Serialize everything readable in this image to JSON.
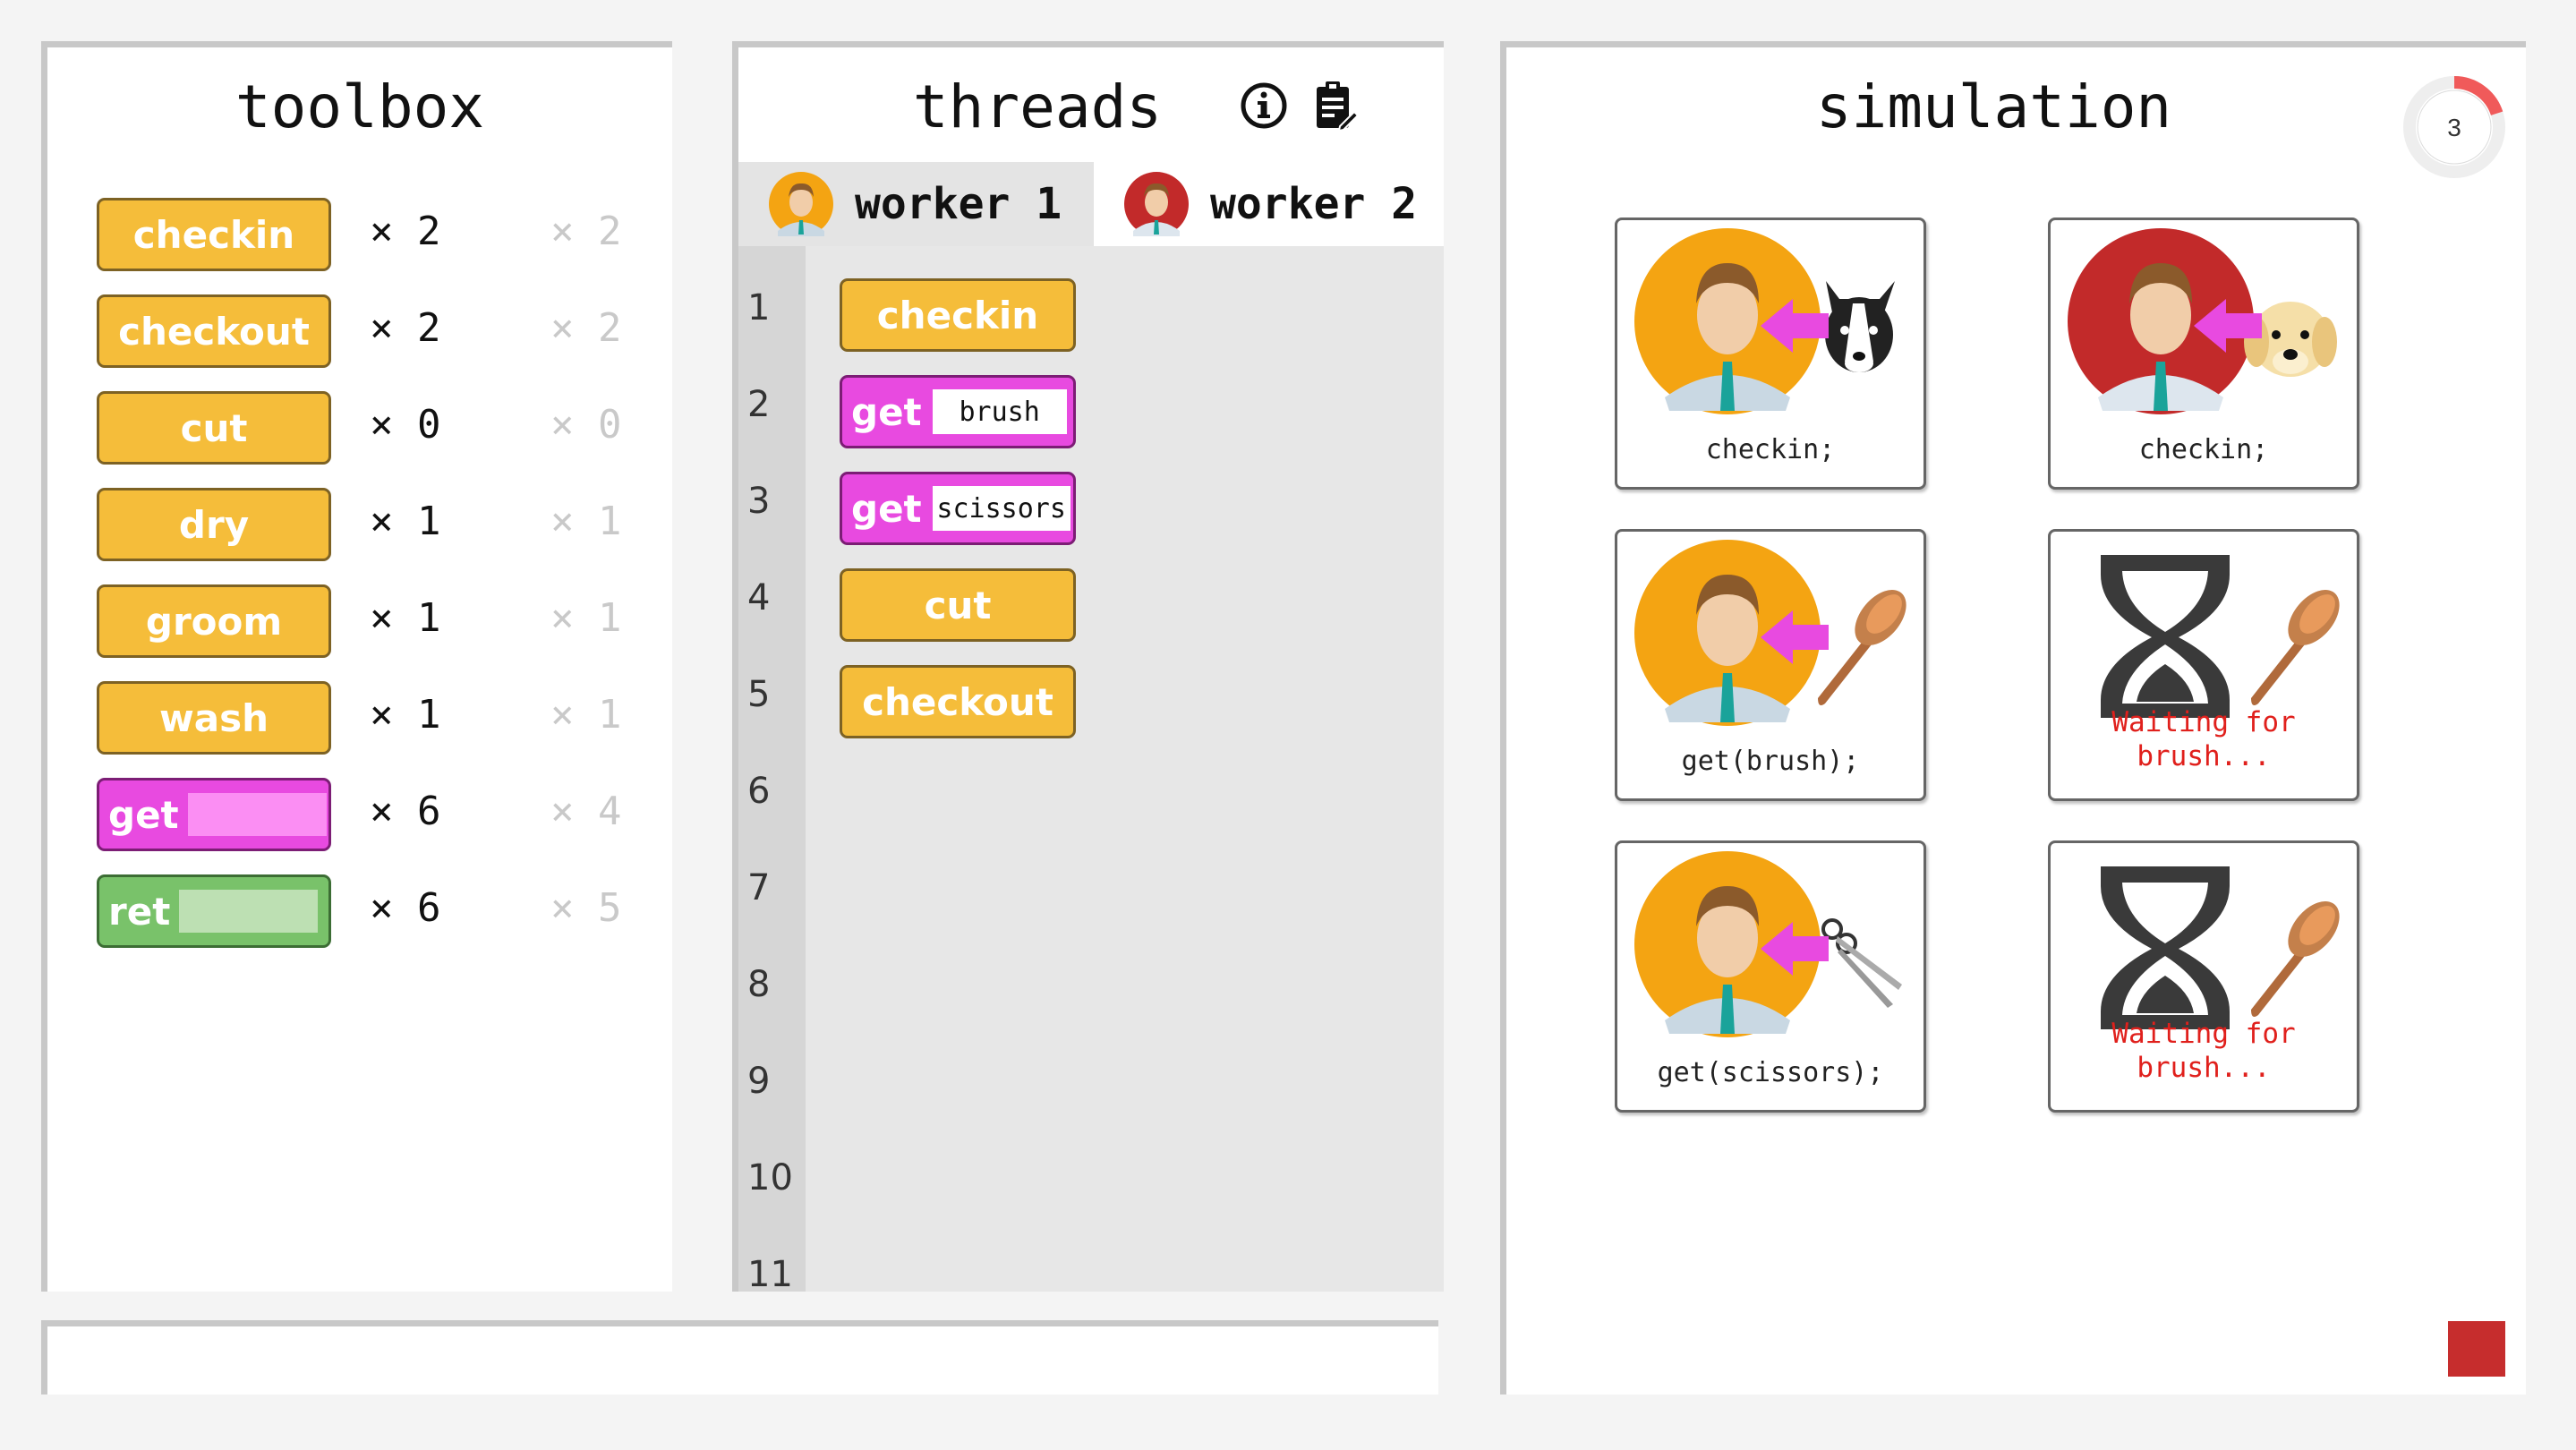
{
  "toolbox": {
    "title": "toolbox",
    "items": [
      {
        "label": "checkin",
        "kind": "orange",
        "count": "× 2",
        "remaining": "× 2"
      },
      {
        "label": "checkout",
        "kind": "orange",
        "count": "× 2",
        "remaining": "× 2"
      },
      {
        "label": "cut",
        "kind": "orange",
        "count": "× 0",
        "remaining": "× 0"
      },
      {
        "label": "dry",
        "kind": "orange",
        "count": "× 1",
        "remaining": "× 1"
      },
      {
        "label": "groom",
        "kind": "orange",
        "count": "× 1",
        "remaining": "× 1"
      },
      {
        "label": "wash",
        "kind": "orange",
        "count": "× 1",
        "remaining": "× 1"
      },
      {
        "label": "get",
        "kind": "magenta",
        "count": "× 6",
        "remaining": "× 4"
      },
      {
        "label": "ret",
        "kind": "green",
        "count": "× 6",
        "remaining": "× 5"
      }
    ]
  },
  "threads": {
    "title": "threads",
    "info_icon": "info-icon",
    "clipboard_icon": "clipboard-icon",
    "tabs": [
      {
        "label": "worker 1",
        "avatar": "orange",
        "active": true
      },
      {
        "label": "worker 2",
        "avatar": "red",
        "active": false
      }
    ],
    "line_numbers": [
      "1",
      "2",
      "3",
      "4",
      "5",
      "6",
      "7",
      "8",
      "9",
      "10",
      "11"
    ],
    "code": [
      {
        "label": "checkin",
        "kind": "orange"
      },
      {
        "label": "get",
        "kind": "magenta",
        "arg": "brush"
      },
      {
        "label": "get",
        "kind": "magenta",
        "arg": "scissors"
      },
      {
        "label": "cut",
        "kind": "orange"
      },
      {
        "label": "checkout",
        "kind": "orange"
      }
    ]
  },
  "simulation": {
    "title": "simulation",
    "timer_value": "3",
    "timer_progress": 0.2,
    "colors": {
      "worker1": "#f4a412",
      "worker2": "#c22a2a",
      "arrow": "#e84ae0",
      "wait_text": "#e0201c",
      "stop": "#c62d2d"
    },
    "cards": [
      {
        "text": "checkin;",
        "type": "worker",
        "worker": "worker1",
        "item": "dog-black"
      },
      {
        "text": "checkin;",
        "type": "worker",
        "worker": "worker2",
        "item": "dog-yellow"
      },
      {
        "text": "get(brush);",
        "type": "worker",
        "worker": "worker1",
        "item": "brush"
      },
      {
        "text": "Waiting for brush...",
        "type": "wait",
        "item": "brush"
      },
      {
        "text": "get(scissors);",
        "type": "worker",
        "worker": "worker1",
        "item": "scissors"
      },
      {
        "text": "Waiting for brush...",
        "type": "wait",
        "item": "brush"
      }
    ]
  }
}
